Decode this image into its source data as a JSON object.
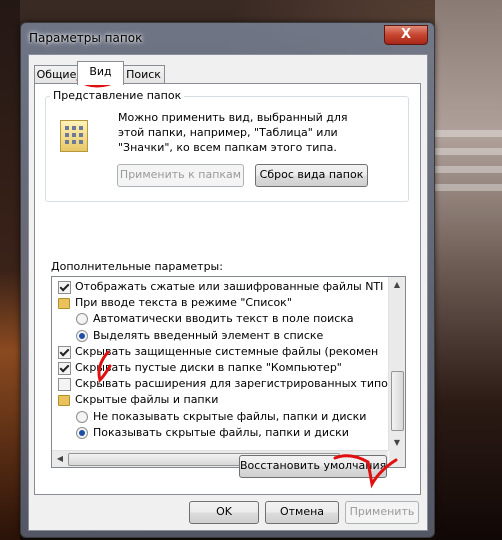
{
  "window": {
    "title": "Параметры папок",
    "close_label": "X"
  },
  "tabs": [
    {
      "label": "Общие",
      "active": false
    },
    {
      "label": "Вид",
      "active": true
    },
    {
      "label": "Поиск",
      "active": false
    }
  ],
  "folder_views": {
    "group_label": "Представление папок",
    "description": "Можно применить вид, выбранный для этой папки, например, \"Таблица\" или \"Значки\", ко всем папкам этого типа.",
    "apply_button": "Применить к папкам",
    "reset_button": "Сброс вида папок"
  },
  "advanced": {
    "label": "Дополнительные параметры:",
    "items": [
      {
        "type": "checkbox",
        "checked": true,
        "indent": 0,
        "text": "Отображать сжатые или зашифрованные файлы NTI"
      },
      {
        "type": "folder",
        "indent": 0,
        "text": "При вводе текста в режиме \"Список\""
      },
      {
        "type": "radio",
        "checked": false,
        "indent": 1,
        "text": "Автоматически вводить текст в поле поиска"
      },
      {
        "type": "radio",
        "checked": true,
        "indent": 1,
        "text": "Выделять введенный элемент в списке"
      },
      {
        "type": "checkbox",
        "checked": true,
        "indent": 0,
        "text": "Скрывать защищенные системные файлы (рекомен"
      },
      {
        "type": "checkbox",
        "checked": true,
        "indent": 0,
        "text": "Скрывать пустые диски в папке \"Компьютер\""
      },
      {
        "type": "checkbox",
        "checked": false,
        "indent": 0,
        "text": "Скрывать расширения для зарегистрированных типо"
      },
      {
        "type": "folder",
        "indent": 0,
        "text": "Скрытые файлы и папки"
      },
      {
        "type": "radio",
        "checked": false,
        "indent": 1,
        "text": "Не показывать скрытые файлы, папки и диски"
      },
      {
        "type": "radio",
        "checked": true,
        "indent": 1,
        "text": "Показывать скрытые файлы, папки и диски"
      }
    ],
    "restore_button": "Восстановить умолчания"
  },
  "footer": {
    "ok": "OK",
    "cancel": "Отмена",
    "apply": "Применить"
  },
  "colors": {
    "annotation": "#e01010",
    "radio_dot": "#1e4fa8",
    "close_button": "#c7452f"
  }
}
